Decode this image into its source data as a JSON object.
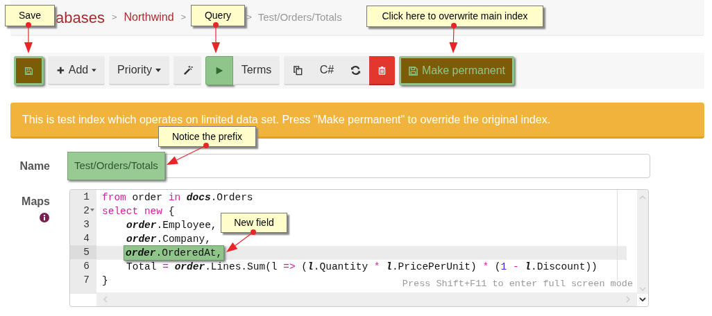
{
  "breadcrumb": [
    {
      "kind": "title",
      "text": "abases"
    },
    {
      "kind": "separator",
      "text": ">"
    },
    {
      "kind": "link",
      "text": "Northwind"
    },
    {
      "kind": "separator",
      "text": ">"
    },
    {
      "kind": "separator",
      "text": ">"
    },
    {
      "kind": "current",
      "text": "Test/Orders/Totals"
    }
  ],
  "toolbar": [
    {
      "kind": "icon",
      "highlighted": true
    },
    {
      "kind": "dropdown",
      "label": "Add"
    },
    {
      "kind": "dropdown",
      "label": "Priority"
    },
    {
      "kind": "icon"
    },
    {
      "kind": "icon",
      "highlighted": true
    },
    {
      "kind": "text",
      "label": "Terms"
    },
    {
      "kind": "icon"
    },
    {
      "kind": "text",
      "label": "C#"
    },
    {
      "kind": "icon"
    },
    {
      "kind": "danger"
    },
    {
      "kind": "text",
      "label": "Make permanent",
      "highlighted": true
    }
  ],
  "alert": "This is test index which operates on limited data set. Press \"Make permanent\" to override the original index.",
  "name_field": {
    "label": "Name",
    "value": "Test/Orders/Totals",
    "highlighted": true
  },
  "maps": {
    "label": "Maps",
    "hint": "Press Shift+F11 to enter full screen mode",
    "lines": [
      {
        "number": "1",
        "tokens": [
          {
            "kind": "keyword",
            "text": "from"
          },
          {
            "kind": "plain",
            "text": " order "
          },
          {
            "kind": "keyword",
            "text": "in "
          },
          {
            "kind": "var",
            "text": "docs"
          },
          {
            "kind": "plain",
            "text": ".Orders"
          }
        ]
      },
      {
        "number": "2",
        "foldable": true,
        "tokens": [
          {
            "kind": "keyword",
            "text": "select new"
          },
          {
            "kind": "plain",
            "text": " {"
          }
        ]
      },
      {
        "number": "3",
        "indented": true,
        "tokens": [
          {
            "kind": "var",
            "text": "order"
          },
          {
            "kind": "plain",
            "text": ".Employee,"
          }
        ]
      },
      {
        "number": "4",
        "indented": true,
        "tokens": [
          {
            "kind": "var",
            "text": "order"
          },
          {
            "kind": "plain",
            "text": ".Company,"
          }
        ]
      },
      {
        "number": "5",
        "indented": true,
        "active": true,
        "highlighted": true,
        "tokens": [
          {
            "kind": "var",
            "text": "order"
          },
          {
            "kind": "plain",
            "text": ".OrderedAt,"
          }
        ]
      },
      {
        "number": "6",
        "indented": true,
        "tokens": [
          {
            "kind": "plain",
            "text": "Total "
          },
          {
            "kind": "op",
            "text": "= "
          },
          {
            "kind": "var",
            "text": "order"
          },
          {
            "kind": "plain",
            "text": ".Lines.Sum(l "
          },
          {
            "kind": "op",
            "text": "=>"
          },
          {
            "kind": "plain",
            "text": " ("
          },
          {
            "kind": "var",
            "text": "l"
          },
          {
            "kind": "plain",
            "text": ".Quantity "
          },
          {
            "kind": "op",
            "text": "* "
          },
          {
            "kind": "var",
            "text": "l"
          },
          {
            "kind": "plain",
            "text": ".PricePerUnit) "
          },
          {
            "kind": "op",
            "text": "*"
          },
          {
            "kind": "plain",
            "text": " ("
          },
          {
            "kind": "number",
            "text": "1"
          },
          {
            "kind": "op",
            "text": " - "
          },
          {
            "kind": "var",
            "text": "l"
          },
          {
            "kind": "plain",
            "text": ".Discount))"
          }
        ]
      },
      {
        "number": "7",
        "tokens": [
          {
            "kind": "plain",
            "text": "}"
          }
        ]
      }
    ]
  },
  "callouts": [
    {
      "text": "Save"
    },
    {
      "text": "Query"
    },
    {
      "text": "Click here to overwrite main index"
    },
    {
      "text": "Notice the prefix"
    },
    {
      "text": "New field"
    }
  ]
}
